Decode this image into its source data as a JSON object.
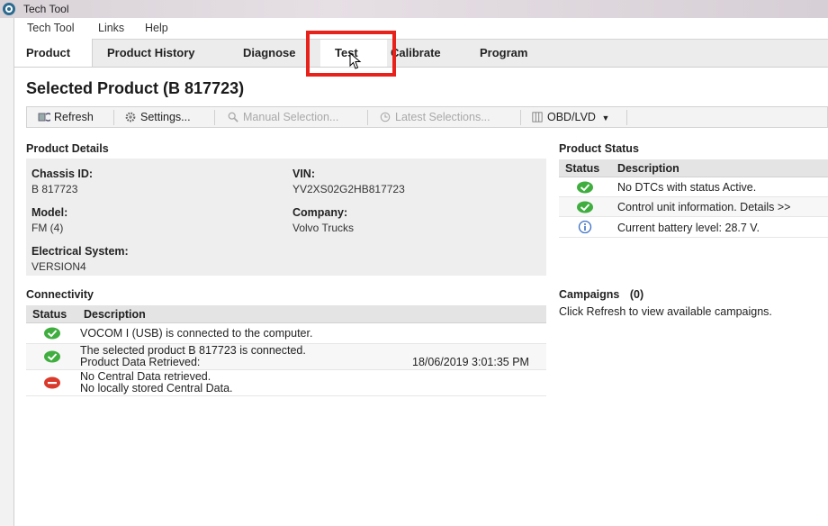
{
  "window": {
    "title": "Tech Tool"
  },
  "menu": [
    "Tech Tool",
    "Links",
    "Help"
  ],
  "tabs": [
    "Product",
    "Product History",
    "Diagnose",
    "Test",
    "Calibrate",
    "Program"
  ],
  "page_title": "Selected Product (B 817723)",
  "toolbar": {
    "refresh": "Refresh",
    "settings": "Settings...",
    "manual_selection": "Manual Selection...",
    "latest_selections": "Latest Selections...",
    "obd": "OBD/LVD"
  },
  "product_details": {
    "title": "Product Details",
    "chassis_label": "Chassis ID:",
    "chassis_value": "B 817723",
    "vin_label": "VIN:",
    "vin_value": "YV2XS02G2HB817723",
    "model_label": "Model:",
    "model_value": "FM (4)",
    "company_label": "Company:",
    "company_value": "Volvo Trucks",
    "electrical_label": "Electrical System:",
    "electrical_value": "VERSION4"
  },
  "product_status": {
    "title": "Product Status",
    "col_status": "Status",
    "col_description": "Description",
    "rows": [
      {
        "icon": "ok",
        "text": "No DTCs with status Active."
      },
      {
        "icon": "ok",
        "text": "Control unit information. Details >>"
      },
      {
        "icon": "info",
        "text": "Current battery level: 28.7 V."
      }
    ]
  },
  "connectivity": {
    "title": "Connectivity",
    "col_status": "Status",
    "col_description": "Description",
    "rows": [
      {
        "icon": "ok",
        "line1": "VOCOM I (USB) is connected to the computer.",
        "line2": "",
        "date": ""
      },
      {
        "icon": "ok",
        "line1": "The selected product B 817723 is connected.",
        "line2": "Product Data Retrieved:",
        "date": "18/06/2019 3:01:35 PM"
      },
      {
        "icon": "error",
        "line1": "No Central Data retrieved.",
        "line2": "No locally stored Central Data.",
        "date": ""
      }
    ]
  },
  "campaigns": {
    "title": "Campaigns",
    "count": "(0)",
    "message": "Click Refresh to view available campaigns."
  },
  "colors": {
    "ok": "#3fae3f",
    "error": "#d93a2b",
    "info": "#3a6fc4",
    "highlight": "#e8221b"
  }
}
